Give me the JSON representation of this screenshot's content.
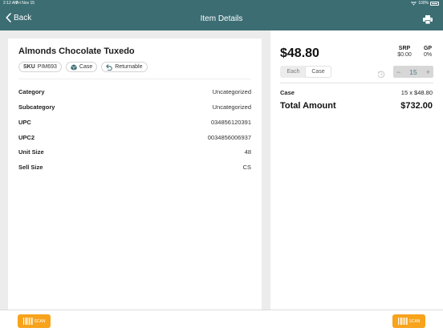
{
  "status_bar": {
    "time": "2:12 AM",
    "date": "Fri Nov 15",
    "battery": "100%"
  },
  "nav": {
    "back_label": "Back",
    "title": "Item Details",
    "print_icon": "print-icon"
  },
  "item": {
    "name": "Almonds Chocolate Tuxedo",
    "chips": {
      "sku_label": "SKU",
      "sku_value": "PIM693",
      "unit": "Case",
      "returnable": "Returnable"
    },
    "attributes": [
      {
        "key": "Category",
        "value": "Uncategorized"
      },
      {
        "key": "Subcategory",
        "value": "Uncategorized"
      },
      {
        "key": "UPC",
        "value": "034856120391"
      },
      {
        "key": "UPC2",
        "value": "0034856006937"
      },
      {
        "key": "Unit Size",
        "value": "48"
      },
      {
        "key": "Sell Size",
        "value": "CS"
      }
    ]
  },
  "pricing": {
    "price": "$48.80",
    "srp_label": "SRP",
    "srp_value": "$0.00",
    "gp_label": "GP",
    "gp_value": "0%",
    "unit_options": [
      "Each",
      "Case"
    ],
    "selected_unit": "Case",
    "quantity": "15",
    "minus": "−",
    "plus": "+",
    "line_label": "Case",
    "line_value": "15 x $48.80",
    "total_label": "Total Amount",
    "total_value": "$732.00"
  },
  "bottom": {
    "scan_label": "SCAN"
  },
  "colors": {
    "header": "#3b6d73",
    "scan_button": "#f7a31c",
    "quantity_text": "#4e7c82"
  }
}
